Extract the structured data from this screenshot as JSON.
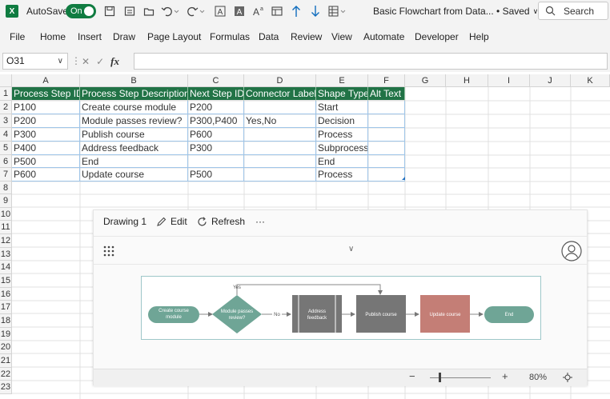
{
  "titlebar": {
    "app_icon": "excel-logo-icon",
    "app_icon_letter": "X",
    "autosave_label": "AutoSave",
    "autosave_state": "On",
    "document_title": "Basic Flowchart from Data... • Saved",
    "search_label": "Search"
  },
  "menu": [
    "File",
    "Home",
    "Insert",
    "Draw",
    "Page Layout",
    "Formulas",
    "Data",
    "Review",
    "View",
    "Automate",
    "Developer",
    "Help"
  ],
  "formula_bar": {
    "name_box": "O31",
    "formula": ""
  },
  "columns": [
    "A",
    "B",
    "C",
    "D",
    "E",
    "F",
    "G",
    "H",
    "I",
    "J",
    "K"
  ],
  "rows": [
    "1",
    "2",
    "3",
    "4",
    "5",
    "6",
    "7",
    "8",
    "9",
    "10",
    "11",
    "12",
    "13",
    "14",
    "15",
    "16",
    "17",
    "18",
    "19",
    "20",
    "21",
    "22",
    "23"
  ],
  "table": {
    "headers": [
      "Process Step ID",
      "Process Step Description",
      "Next Step ID",
      "Connector Label",
      "Shape Type",
      "Alt Text"
    ],
    "rows": [
      [
        "P100",
        "Create course module",
        "P200",
        "",
        "Start",
        ""
      ],
      [
        "P200",
        "Module passes review?",
        "P300,P400",
        "Yes,No",
        "Decision",
        ""
      ],
      [
        "P300",
        "Publish course",
        "P600",
        "",
        "Process",
        ""
      ],
      [
        "P400",
        "Address feedback",
        "P300",
        "",
        "Subprocess",
        ""
      ],
      [
        "P500",
        "End",
        "",
        "",
        "End",
        ""
      ],
      [
        "P600",
        "Update course",
        "P500",
        "",
        "Process",
        ""
      ]
    ]
  },
  "drawing": {
    "title": "Drawing 1",
    "edit_label": "Edit",
    "refresh_label": "Refresh",
    "more_label": "···",
    "zoom_level": "80%",
    "zoom_minus": "−",
    "zoom_plus": "+",
    "flow": {
      "start": "Create course module",
      "decision": "Module passes review?",
      "yes_label": "Yes",
      "no_label": "No",
      "subprocess": "Address feedback",
      "process1": "Publish course",
      "process2": "Update course",
      "end": "End"
    }
  },
  "colors": {
    "header_green": "#217346",
    "excel_green": "#107c41",
    "teal_shape": "#6fa596",
    "gray_shape": "#767676",
    "rose_shape": "#c47e76"
  }
}
